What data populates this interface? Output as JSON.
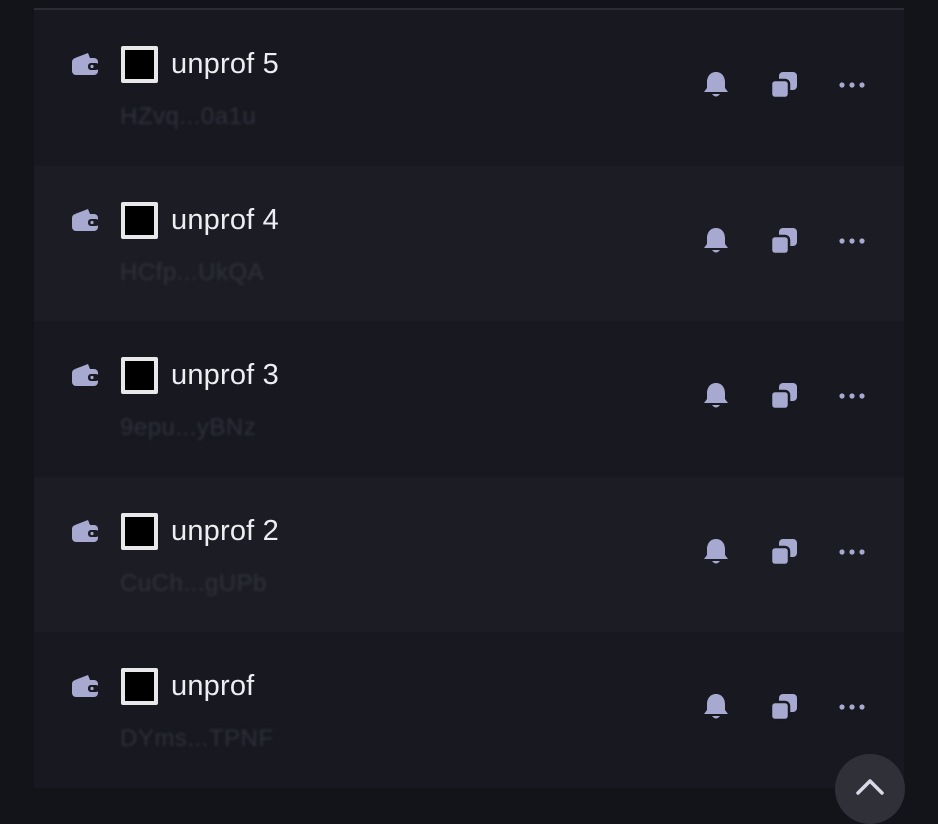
{
  "colors": {
    "icon": "#a7a9d1",
    "text": "#eceef2",
    "address": "#2f313b"
  },
  "wallets": [
    {
      "name": "unprof 5",
      "address": "HZvq...0a1u",
      "icons": [
        "wallet-icon",
        "bell-icon",
        "copy-icon",
        "more-icon"
      ]
    },
    {
      "name": "unprof 4",
      "address": "HCfp...UkQA",
      "icons": [
        "wallet-icon",
        "bell-icon",
        "copy-icon",
        "more-icon"
      ]
    },
    {
      "name": "unprof 3",
      "address": "9epu...yBNz",
      "icons": [
        "wallet-icon",
        "bell-icon",
        "copy-icon",
        "more-icon"
      ]
    },
    {
      "name": "unprof 2",
      "address": "CuCh...gUPb",
      "icons": [
        "wallet-icon",
        "bell-icon",
        "copy-icon",
        "more-icon"
      ]
    },
    {
      "name": "unprof",
      "address": "DYms...TPNF",
      "icons": [
        "wallet-icon",
        "bell-icon",
        "copy-icon",
        "more-icon"
      ]
    }
  ],
  "scroll_top_icon": "chevron-up-icon"
}
